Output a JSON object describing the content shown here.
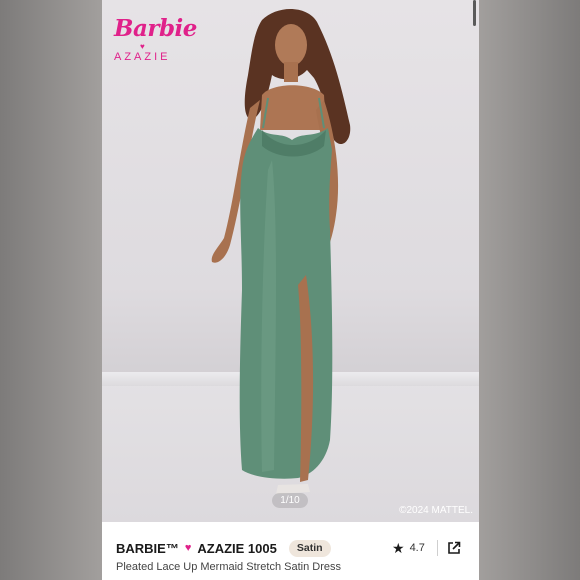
{
  "brand": {
    "barbie_logo": "Barbie",
    "partner": "AZAZIE"
  },
  "image": {
    "counter": "1/10",
    "copyright": "©2024 MATTEL."
  },
  "product": {
    "title_left": "BARBIE™",
    "title_right": "AZAZIE 1005",
    "material_badge": "Satin",
    "rating": "4.7",
    "subtitle": "Pleated Lace Up Mermaid Stretch Satin Dress"
  },
  "icons": {
    "heart": "heart-icon",
    "star": "star-icon",
    "share": "share-external-icon"
  },
  "colors": {
    "brand_pink": "#e0218a",
    "dress_green": "#5f8f78",
    "badge_bg": "#efe6dc"
  }
}
